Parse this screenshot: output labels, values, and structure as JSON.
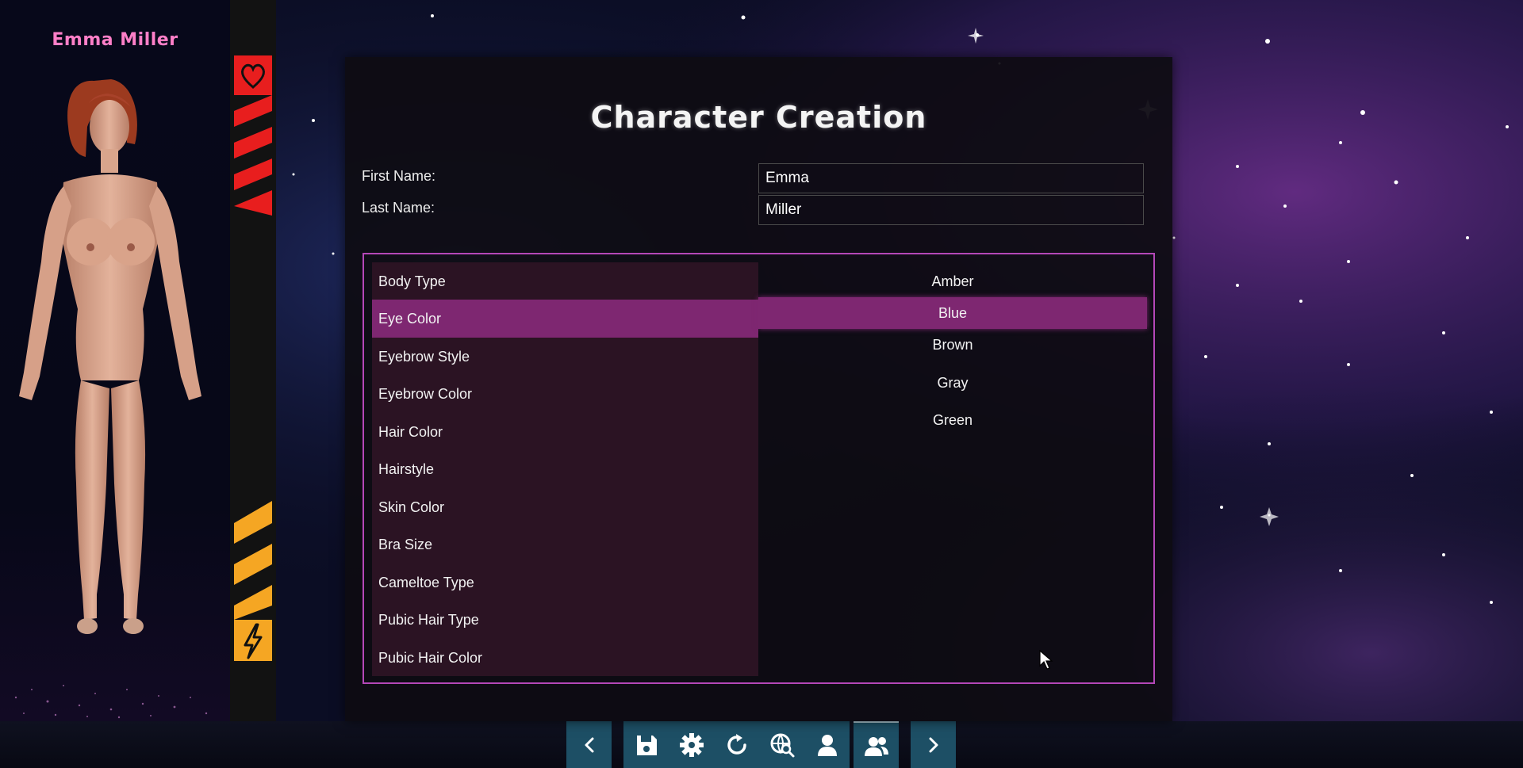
{
  "character": {
    "name": "Emma Miller"
  },
  "status_bar": {
    "top_icon": "heart-icon",
    "bottom_icon": "lightning-icon",
    "colors": {
      "mood": "#ff2020",
      "energy": "#f5a623"
    }
  },
  "dialog": {
    "title": "Character Creation",
    "first_name": {
      "label": "First Name:",
      "value": "Emma"
    },
    "last_name": {
      "label": "Last Name:",
      "value": "Miller"
    },
    "categories": [
      {
        "label": "Body Type"
      },
      {
        "label": "Eye Color",
        "selected": true
      },
      {
        "label": "Eyebrow Style"
      },
      {
        "label": "Eyebrow Color"
      },
      {
        "label": "Hair Color"
      },
      {
        "label": "Hairstyle"
      },
      {
        "label": "Skin Color"
      },
      {
        "label": "Bra Size"
      },
      {
        "label": "Cameltoe Type"
      },
      {
        "label": "Pubic Hair Type"
      },
      {
        "label": "Pubic Hair Color"
      }
    ],
    "values": [
      {
        "label": "Amber"
      },
      {
        "label": "Blue",
        "selected": true
      },
      {
        "label": "Brown"
      },
      {
        "label": "Gray"
      },
      {
        "label": "Green"
      }
    ],
    "accent_color": "#b447b8",
    "selection_color": "#7e2771"
  },
  "toolbar": {
    "buttons": [
      {
        "name": "back-button",
        "icon": "chevron-left-icon"
      },
      {
        "name": "save-button",
        "icon": "save-icon"
      },
      {
        "name": "settings-button",
        "icon": "gear-icon"
      },
      {
        "name": "reset-button",
        "icon": "rotate-icon"
      },
      {
        "name": "inspect-button",
        "icon": "globe-search-icon"
      },
      {
        "name": "character-button",
        "icon": "person-icon"
      },
      {
        "name": "characters-button",
        "icon": "people-icon",
        "active": true
      },
      {
        "name": "next-button",
        "icon": "chevron-right-icon"
      }
    ],
    "color": "#1d4f65"
  }
}
